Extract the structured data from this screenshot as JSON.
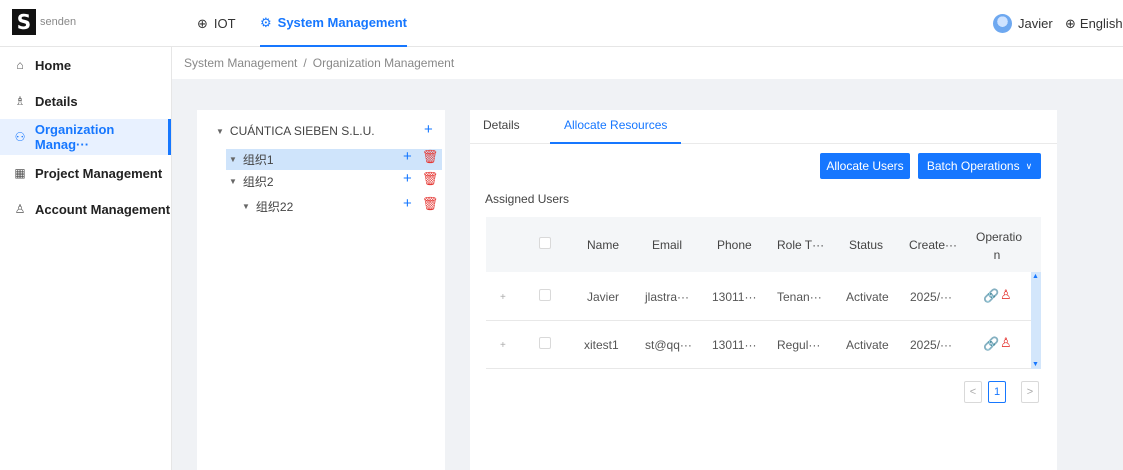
{
  "brand": {
    "mark": "S",
    "name": "senden"
  },
  "topnav": [
    {
      "label": "IOT",
      "icon": "globe-icon"
    },
    {
      "label": "System Management",
      "icon": "gear-icon"
    }
  ],
  "user": {
    "name": "Javier",
    "language": "English"
  },
  "sidebar": {
    "items": [
      {
        "label": "Home",
        "icon": "home-icon"
      },
      {
        "label": "Details",
        "icon": "people-icon"
      },
      {
        "label": "Organization Manag···",
        "icon": "org-icon",
        "active": true
      },
      {
        "label": "Project Management",
        "icon": "grid-icon"
      },
      {
        "label": "Account Management",
        "icon": "person-icon"
      }
    ]
  },
  "breadcrumb": {
    "parent": "System Management",
    "separator": "/",
    "current": "Organization Management"
  },
  "tree": {
    "root": "CUÁNTICA SIEBEN S.L.U.",
    "nodes": [
      {
        "label": "组织1",
        "selected": true
      },
      {
        "label": "组织2"
      },
      {
        "label": "组织22"
      }
    ]
  },
  "tabs": [
    {
      "label": "Details"
    },
    {
      "label": "Allocate Resources",
      "active": true
    }
  ],
  "buttons": {
    "allocate_users": "Allocate Users",
    "batch_operations": "Batch Operations"
  },
  "assigned_users_label": "Assigned Users",
  "table": {
    "columns": [
      "Name",
      "Email",
      "Phone",
      "Role T···",
      "Status",
      "Create···",
      "Operatio",
      "n"
    ],
    "rows": [
      {
        "name": "Javier",
        "email": "jlastra···",
        "phone": "13011···",
        "role": "Tenan···",
        "status": "Activate",
        "created": "2025/···"
      },
      {
        "name": "xitest1",
        "email": "st@qq···",
        "phone": "13011···",
        "role": "Regul···",
        "status": "Activate",
        "created": "2025/···"
      }
    ]
  },
  "pagination": {
    "prev": "<",
    "page": "1",
    "next": ">"
  },
  "colors": {
    "accent": "#1677ff",
    "danger": "#e53935",
    "selected_bg": "#cfe4fb"
  }
}
